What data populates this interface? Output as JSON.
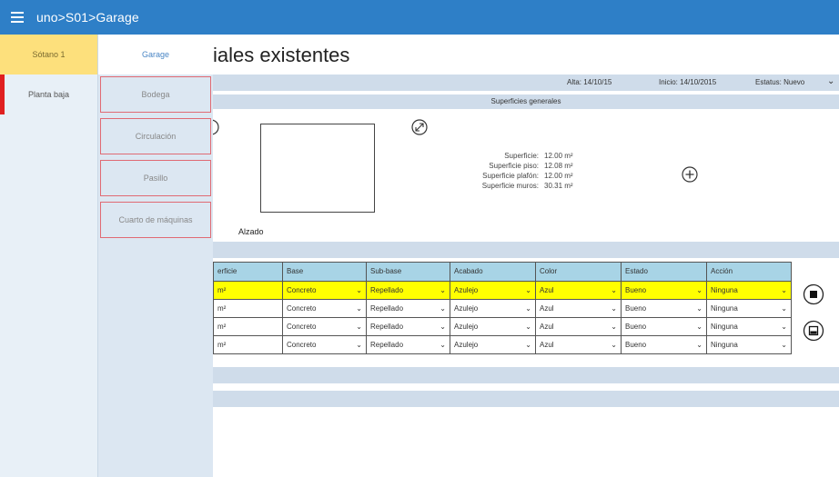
{
  "header": {
    "breadcrumb": "uno>S01>Garage"
  },
  "levels": [
    {
      "label": "Sótano 1"
    },
    {
      "label": "Planta baja"
    }
  ],
  "rooms": [
    {
      "label": "Garage"
    },
    {
      "label": "Bodega"
    },
    {
      "label": "Circulación"
    },
    {
      "label": "Pasillo"
    },
    {
      "label": "Cuarto de máquinas"
    }
  ],
  "main": {
    "title": "iales existentes",
    "info": {
      "alta": "Alta: 14/10/15",
      "inicio": "Inicio: 14/10/2015",
      "estatus": "Estatus: Nuevo"
    },
    "section_title": "Superficies generales",
    "alzado_label": "Alzado",
    "metrics": [
      {
        "label": "Superficie:",
        "value": "12.00 m²"
      },
      {
        "label": "Superficie piso:",
        "value": "12.08 m²"
      },
      {
        "label": "Superficie plafón:",
        "value": "12.00 m²"
      },
      {
        "label": "Superficie muros:",
        "value": "30.31 m²"
      }
    ]
  },
  "table": {
    "headers": [
      "erficie",
      "Base",
      "Sub-base",
      "Acabado",
      "Color",
      "Estado",
      "Acción"
    ],
    "rows": [
      [
        "m²",
        "Concreto",
        "Repellado",
        "Azulejo",
        "Azul",
        "Bueno",
        "Ninguna"
      ],
      [
        "m²",
        "Concreto",
        "Repellado",
        "Azulejo",
        "Azul",
        "Bueno",
        "Ninguna"
      ],
      [
        "m²",
        "Concreto",
        "Repellado",
        "Azulejo",
        "Azul",
        "Bueno",
        "Ninguna"
      ],
      [
        "m²",
        "Concreto",
        "Repellado",
        "Azulejo",
        "Azul",
        "Bueno",
        "Ninguna"
      ]
    ]
  },
  "colors": {
    "accent": "#2e7fc7",
    "highlight": "#ffff00",
    "active_level": "#fde07c",
    "alert": "#e02020"
  },
  "icons": [
    "menu-icon",
    "rotate-icon",
    "expand-icon",
    "add-icon",
    "stop-icon",
    "save-icon",
    "chevron-down-icon"
  ]
}
